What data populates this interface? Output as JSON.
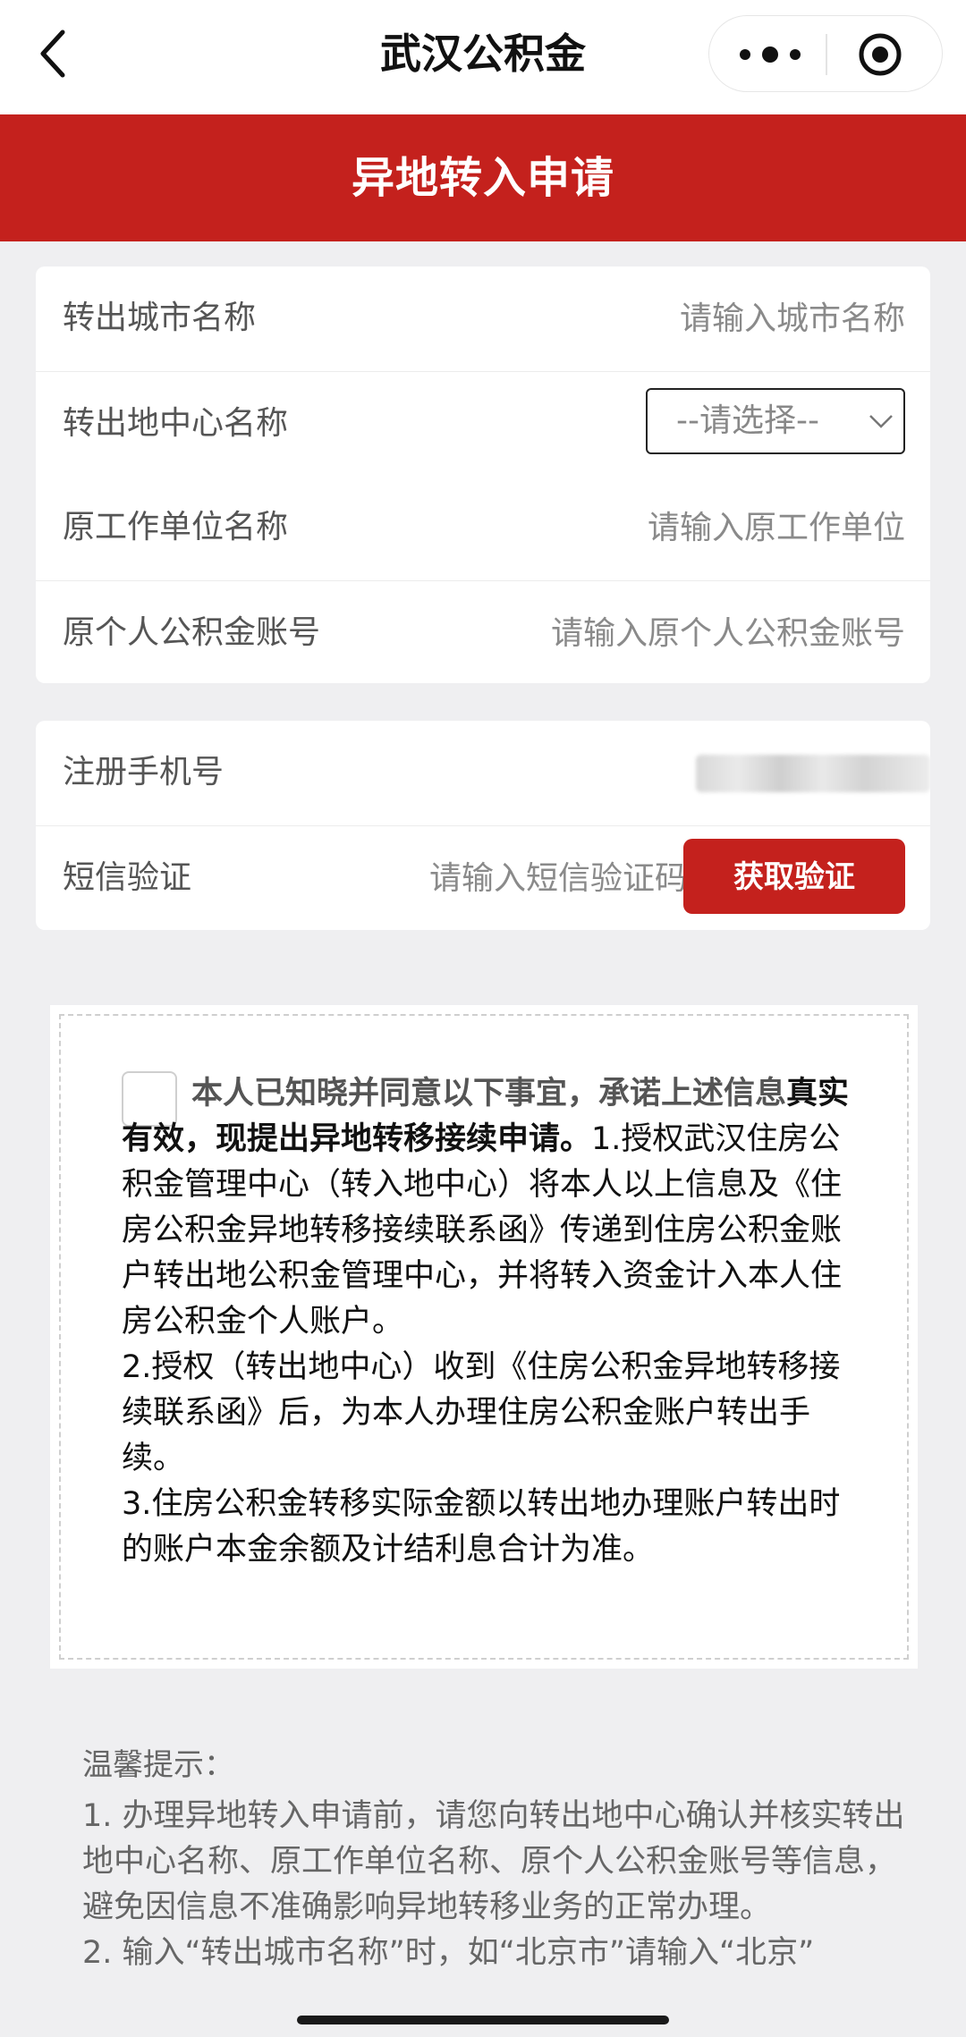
{
  "nav": {
    "title": "武汉公积金"
  },
  "banner": {
    "title": "异地转入申请"
  },
  "form": {
    "out_city": {
      "label": "转出城市名称",
      "placeholder": "请输入城市名称"
    },
    "out_center": {
      "label": "转出地中心名称",
      "selected": "--请选择--"
    },
    "orig_employer": {
      "label": "原工作单位名称",
      "placeholder": "请输入原工作单位"
    },
    "orig_account": {
      "label": "原个人公积金账号",
      "placeholder": "请输入原个人公积金账号"
    }
  },
  "verify": {
    "phone": {
      "label": "注册手机号",
      "value": ""
    },
    "sms": {
      "label": "短信验证",
      "placeholder": "请输入短信验证码",
      "button": "获取验证"
    }
  },
  "agreement": {
    "lead_gray": "本人已知晓并同意以下事宜，承诺上述信息",
    "lead_black": "真实有效，现提出异地转移接续申请。",
    "item1": "1.授权武汉住房公积金管理中心（转入地中心）将本人以上信息及《住房公积金异地转移接续联系函》传递到住房公积金账户转出地公积金管理中心，并将转入资金计入本人住房公积金个人账户。",
    "item2": "2.授权（转出地中心）收到《住房公积金异地转移接续联系函》后，为本人办理住房公积金账户转出手续。",
    "item3": "3.住房公积金转移实际金额以转出地办理账户转出时的账户本金余额及计结利息合计为准。"
  },
  "tips": {
    "title": "温馨提示：",
    "item1": "1. 办理异地转入申请前，请您向转出地中心确认并核实转出地中心名称、原工作单位名称、原个人公积金账号等信息，避免因信息不准确影响异地转移业务的正常办理。",
    "item2": "2. 输入“转出城市名称”时，如“北京市”请输入“北京”"
  }
}
